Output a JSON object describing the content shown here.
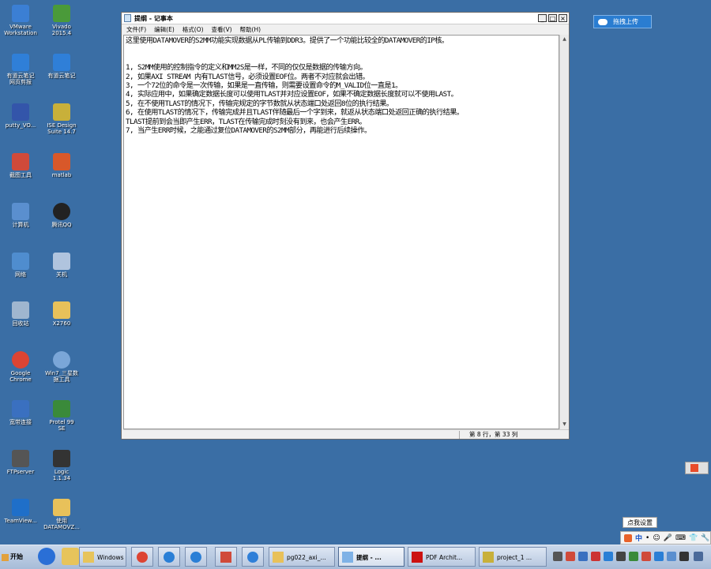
{
  "desktop_icons": [
    {
      "label": "VMware\nWorkstation",
      "icon": "vmware-icon",
      "color": "#3b7fd4"
    },
    {
      "label": "Vivado\n2015.4",
      "icon": "vivado-icon",
      "color": "#4a9a3a"
    },
    {
      "label": "有道云笔记\n网页剪报",
      "icon": "youdao-clip-icon",
      "color": "#2f7fd8"
    },
    {
      "label": "有道云笔记",
      "icon": "youdao-note-icon",
      "color": "#2f7fd8"
    },
    {
      "label": "putty_VO...",
      "icon": "putty-icon",
      "color": "#3355aa"
    },
    {
      "label": "ISE Design\nSuite 14.7",
      "icon": "ise-icon",
      "color": "#c8b03a"
    },
    {
      "label": "截图工具",
      "icon": "snipping-tool-icon",
      "color": "#d04a3a"
    },
    {
      "label": "matlab",
      "icon": "matlab-icon",
      "color": "#d8582a"
    },
    {
      "label": "计算机",
      "icon": "computer-icon",
      "color": "#5a8fcf"
    },
    {
      "label": "腾讯QQ",
      "icon": "qq-icon",
      "color": "#222222"
    },
    {
      "label": "网络",
      "icon": "network-icon",
      "color": "#4f8dcf"
    },
    {
      "label": "关机",
      "icon": "shutdown-icon",
      "color": "#b0c4de"
    },
    {
      "label": "回收站",
      "icon": "recycle-bin-icon",
      "color": "#9fb6cf"
    },
    {
      "label": "X2760",
      "icon": "folder-icon",
      "color": "#e8c15a"
    },
    {
      "label": "Google\nChrome",
      "icon": "chrome-icon",
      "color": "#dd4433"
    },
    {
      "label": "Win7_三星数\n据工具",
      "icon": "samsung-tool-icon",
      "color": "#7aa6d8"
    },
    {
      "label": "宽带连接",
      "icon": "broadband-icon",
      "color": "#3a70c0"
    },
    {
      "label": "Protel 99\nSE",
      "icon": "protel-icon",
      "color": "#3a8a3a"
    },
    {
      "label": "FTPserver",
      "icon": "ftp-server-icon",
      "color": "#555555"
    },
    {
      "label": "Logic\n1.1.34",
      "icon": "logic-icon",
      "color": "#333333"
    },
    {
      "label": "TeamView...",
      "icon": "teamviewer-icon",
      "color": "#1f6fc9"
    },
    {
      "label": "使用\nDATAMOVZ...",
      "icon": "folder-icon",
      "color": "#e8c15a"
    }
  ],
  "notepad": {
    "title": "提纲 - 记事本",
    "menu": [
      "文件(F)",
      "编辑(E)",
      "格式(O)",
      "查看(V)",
      "帮助(H)"
    ],
    "lines": [
      "这里使用DATAMOVER的S2MM功能实现数据从PL传输到DDR3。提供了一个功能比较全的DATAMOVER的IP核。",
      "",
      "",
      "1, S2MM使用的控制指令的定义和MM2S是一样，不同的仅仅是数据的传输方向。",
      "2, 如果AXI STREAM 内有TLAST信号，必须设置EOF位。两者不对应就会出错。",
      "3, 一个72位的命令是一次传输，如果是一直传输，则需要设置命令的M_VALID位一直是1。",
      "4, 实际应用中，如果确定数据长度可以使用TLAST并对应设置EOF，如果不确定数据长度就可以不使用LAST。",
      "5, 在不使用TLAST的情况下，传输完规定的字节数就从状态端口处返回8位的执行结果。",
      "6, 在使用TLAST的情况下，传输完成并且TLAST伴随最后一个字到来，就返从状态端口处返回正确的执行结果。",
      "TLAST提前到会当即产生ERR，TLAST在传输完成时刻没有到来，也会产生ERR。",
      "7, 当产生ERR时候，之能通过复位DATAMOVER的S2MM部分，再能进行后续操作。"
    ],
    "status": "第 8 行，第 33 列"
  },
  "upload_button": "拖拽上传",
  "tooltip": "点我设置",
  "ime": {
    "items": [
      "中",
      "•",
      "☺",
      "🎤",
      "⌨",
      "👕",
      "🔧"
    ]
  },
  "taskbar": {
    "start_label": "开始",
    "quick_launch": [
      {
        "icon": "ie-icon",
        "color": "#2a6fd6"
      },
      {
        "icon": "explorer-icon",
        "color": "#e7c45b"
      }
    ],
    "buttons": [
      {
        "label": "Windows ...",
        "icon": "windows-explorer-icon",
        "color": "#e7c45b",
        "active": false
      },
      {
        "label": "",
        "icon": "chrome-icon",
        "color": "#dd4433",
        "active": false
      },
      {
        "label": "",
        "icon": "sogou-icon",
        "color": "#2a7fd6",
        "active": false
      },
      {
        "label": "",
        "icon": "baidu-cloud-icon",
        "color": "#2a7fd6",
        "active": false
      },
      {
        "label": "",
        "icon": "snipping-tool-icon",
        "color": "#d04a3a",
        "active": false
      },
      {
        "label": "",
        "icon": "note-icon",
        "color": "#2f7fd8",
        "active": false
      },
      {
        "label": "pg022_axi_...",
        "icon": "pdf-reader-icon",
        "color": "#e8c15a",
        "active": false
      },
      {
        "label": "提纲 - ...",
        "icon": "notepad-icon",
        "color": "#7fb2e6",
        "active": true
      },
      {
        "label": "PDF Archit...",
        "icon": "pdf-architect-icon",
        "color": "#cc1111",
        "active": false
      },
      {
        "label": "project_1 ...",
        "icon": "vivado-icon",
        "color": "#c8b03a",
        "active": false
      }
    ],
    "tray": [
      {
        "icon": "tray-app-icon-1",
        "color": "#555555"
      },
      {
        "icon": "tray-app-icon-2",
        "color": "#d04a3a"
      },
      {
        "icon": "tray-app-icon-3",
        "color": "#3a70c0"
      },
      {
        "icon": "tray-app-icon-4",
        "color": "#cc3333"
      },
      {
        "icon": "tray-app-icon-5",
        "color": "#2a7fd6"
      },
      {
        "icon": "tray-app-icon-6",
        "color": "#444444"
      },
      {
        "icon": "tray-app-icon-7",
        "color": "#3a8a3a"
      },
      {
        "icon": "tray-app-icon-8",
        "color": "#d04a3a"
      },
      {
        "icon": "tray-app-icon-9",
        "color": "#2a7fd6"
      },
      {
        "icon": "tray-app-icon-10",
        "color": "#5a8fcf"
      },
      {
        "icon": "tray-app-icon-11",
        "color": "#333333"
      },
      {
        "icon": "tray-app-icon-12",
        "color": "#4a6a9a"
      }
    ]
  }
}
